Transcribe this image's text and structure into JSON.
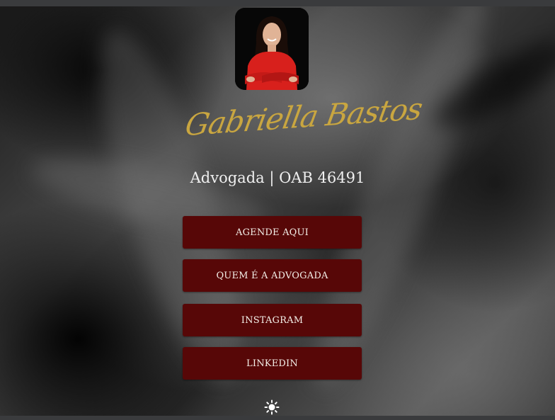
{
  "profile": {
    "name": "Gabriella Bastos",
    "subtitle": "Advogada | OAB 46491"
  },
  "links": [
    {
      "label": "AGENDE AQUI"
    },
    {
      "label": "QUEM É A ADVOGADA"
    },
    {
      "label": "INSTAGRAM"
    },
    {
      "label": "LINKEDIN"
    }
  ],
  "theme_toggle": {
    "icon": "sun-icon"
  },
  "colors": {
    "button_bg": "#570707",
    "name_gold": "#c9a640",
    "text_light": "#efefef"
  }
}
